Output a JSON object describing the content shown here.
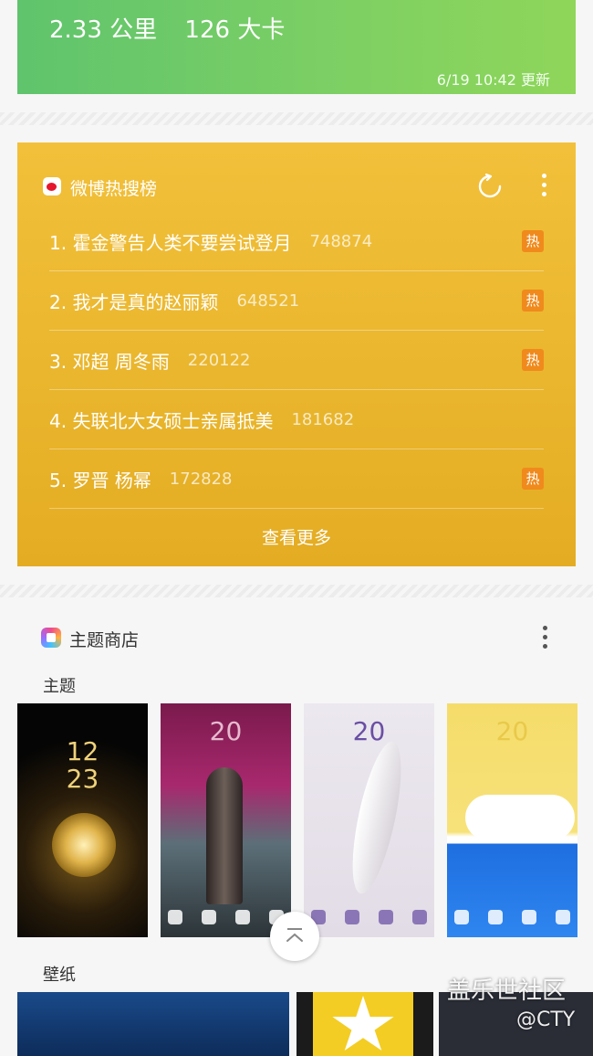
{
  "health": {
    "distance": "2.33 公里",
    "calories": "126 大卡",
    "updated": "6/19 10:42 更新"
  },
  "weibo": {
    "title": "微博热搜榜",
    "icons": {
      "logo": "weibo-logo-icon",
      "refresh": "refresh-icon",
      "more": "more-vertical-icon"
    },
    "items": [
      {
        "label": "1. 霍金警告人类不要尝试登月",
        "count": "748874",
        "badge": "热"
      },
      {
        "label": "2. 我才是真的赵丽颖",
        "count": "648521",
        "badge": "热"
      },
      {
        "label": "3. 邓超 周冬雨",
        "count": "220122",
        "badge": "热"
      },
      {
        "label": "4. 失联北大女硕士亲属抵美",
        "count": "181682",
        "badge": ""
      },
      {
        "label": "5. 罗晋 杨幂",
        "count": "172828",
        "badge": "热"
      }
    ],
    "see_more": "查看更多",
    "colors": {
      "card": "#e9b52c",
      "badge": "#f08a1c"
    }
  },
  "theme_store": {
    "title": "主题商店",
    "themes_label": "主题",
    "wallpapers_label": "壁纸",
    "themes": [
      {
        "clock": "12\n23"
      },
      {
        "clock": "20"
      },
      {
        "clock": "20"
      },
      {
        "clock": "20"
      }
    ]
  },
  "watermark": {
    "line1": "盖乐世社区",
    "line2": "@CTY"
  },
  "health_color": "#6fcb68"
}
